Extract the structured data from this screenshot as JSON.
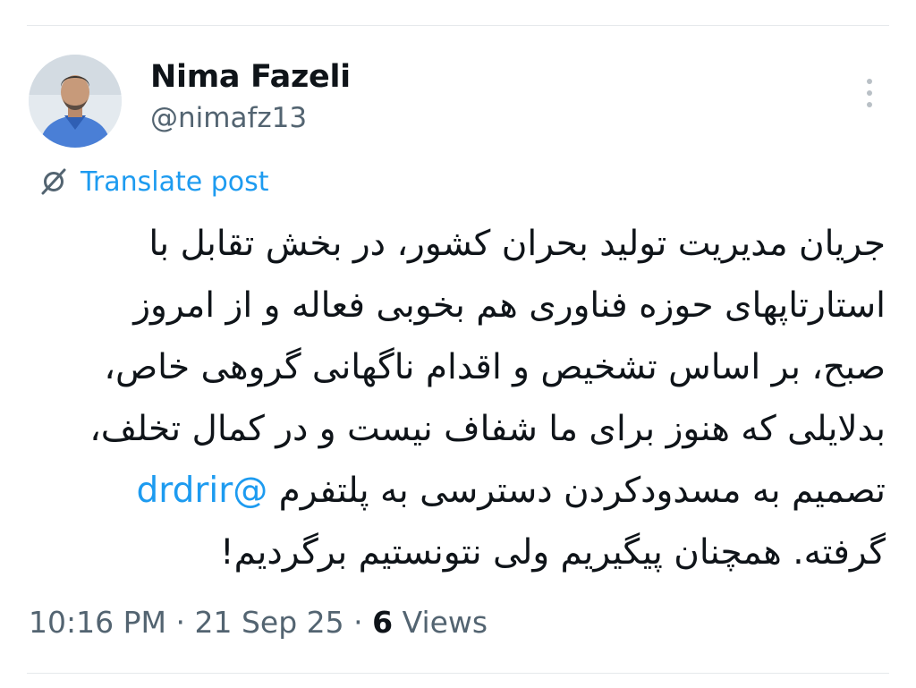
{
  "author": {
    "display_name": "Nima Fazeli",
    "handle": "@nimafz13"
  },
  "translate": {
    "label": "Translate post",
    "icon": "translate-icon"
  },
  "post": {
    "lines": [
      "جریان مدیریت تولید بحران کشور، در بخش تقابل با",
      "استارتاپهای حوزه فناوری هم بخوبی فعاله و از امروز",
      "صبح، بر اساس تشخیص و اقدام ناگهانی گروهی خاص،",
      "بدلایلی که هنوز برای ما شفاف نیست و در کمال تخلف،",
      "تصمیم به مسدودکردن دسترسی به پلتفرم",
      "گرفته. همچنان پیگیریم ولی نتونستیم برگردیم!"
    ],
    "mention": "@drdrir"
  },
  "meta": {
    "time": "10:16 PM",
    "separator": "·",
    "date": "21 Sep 25",
    "views_count": "6",
    "views_label": "Views"
  },
  "colors": {
    "accent": "#1d9bf0",
    "text": "#0f1419",
    "secondary": "#536471"
  }
}
